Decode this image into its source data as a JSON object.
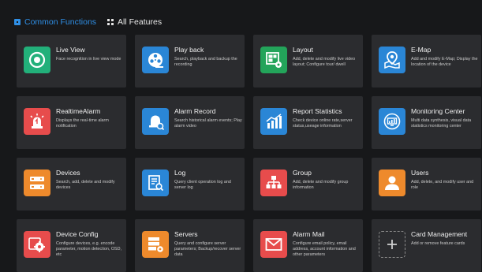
{
  "tabs": {
    "common": "Common Functions",
    "all": "All Features"
  },
  "cards": [
    {
      "title": "Live View",
      "desc": "Face recognition in live view mode",
      "icon": "live-view-icon",
      "color": "#22b07a"
    },
    {
      "title": "Play back",
      "desc": "Search, playback and backup the recording",
      "icon": "playback-reel-icon",
      "color": "#2a86d6"
    },
    {
      "title": "Layout",
      "desc": "Add, delete and modify live video layout; Configure tour/ dwell",
      "icon": "layout-icon",
      "color": "#23a45a"
    },
    {
      "title": "E-Map",
      "desc": "Add and modify E-Map; Display the location of the device",
      "icon": "map-pin-icon",
      "color": "#2a86d6"
    },
    {
      "title": "RealtimeAlarm",
      "desc": "Displays the real-time alarm notification",
      "icon": "alarm-siren-icon",
      "color": "#e74c4c"
    },
    {
      "title": "Alarm Record",
      "desc": "Search historical alarm events; Play alarm video",
      "icon": "alarm-bell-icon",
      "color": "#2a86d6"
    },
    {
      "title": "Report Statistics",
      "desc": "Check device online rate,server status,useage information",
      "icon": "bar-chart-icon",
      "color": "#2a86d6"
    },
    {
      "title": "Monitoring Center",
      "desc": "Multi data synthesis, visual data statistics monitoring center",
      "icon": "monitor-chart-icon",
      "color": "#2a86d6"
    },
    {
      "title": "Devices",
      "desc": "Search, add, delete and modify devices",
      "icon": "devices-icon",
      "color": "#ee8a2c"
    },
    {
      "title": "Log",
      "desc": "Query client operation log and server log",
      "icon": "log-search-icon",
      "color": "#2a86d6"
    },
    {
      "title": "Group",
      "desc": "Add, delete and modify group information",
      "icon": "group-tree-icon",
      "color": "#e74c4c"
    },
    {
      "title": "Users",
      "desc": "Add, delete, and modify user and role",
      "icon": "user-icon",
      "color": "#ee8a2c"
    },
    {
      "title": "Device Config",
      "desc": "Configure devices, e.g. encode parameter, motion detection, OSD, etc",
      "icon": "device-config-gear-icon",
      "color": "#e74c4c"
    },
    {
      "title": "Servers",
      "desc": "Query and configure server parameters; Backup/recover server data",
      "icon": "server-gear-icon",
      "color": "#ee8a2c"
    },
    {
      "title": "Alarm Mail",
      "desc": "Configure email policy, email address, account information and other parameters",
      "icon": "mail-icon",
      "color": "#e74c4c"
    },
    {
      "title": "Card Management",
      "desc": "Add or remove feature cards",
      "icon": "add-card-icon",
      "color": "#8a8a8a"
    }
  ]
}
